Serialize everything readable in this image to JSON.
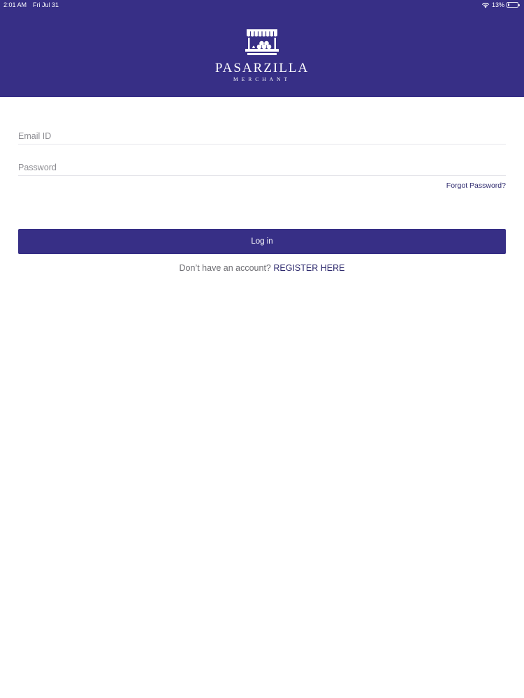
{
  "status_bar": {
    "time": "2:01 AM",
    "date": "Fri Jul 31",
    "battery_percent": "13%",
    "battery_level": 0.13,
    "wifi_icon": "wifi-icon",
    "battery_icon": "battery-icon"
  },
  "brand": {
    "name": "PASARZILLA",
    "subtitle": "MERCHANT",
    "logo_icon": "market-stall-icon"
  },
  "form": {
    "email_placeholder": "Email ID",
    "email_value": "",
    "password_placeholder": "Password",
    "password_value": "",
    "forgot_password_label": "Forgot Password?",
    "login_label": "Log in"
  },
  "register": {
    "prompt": "Don’t have an account?",
    "link_label": "REGISTER HERE"
  },
  "colors": {
    "brand_primary": "#372f86",
    "link": "#2e2a6e",
    "placeholder": "#8e8e93",
    "divider": "#e5e5ea"
  }
}
